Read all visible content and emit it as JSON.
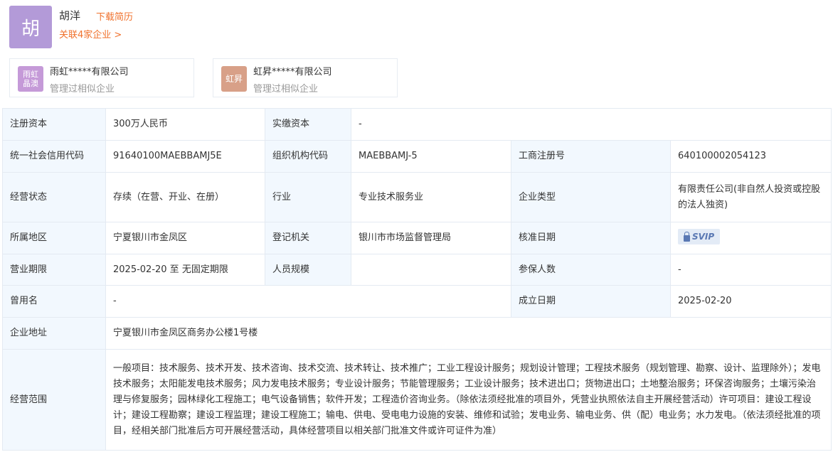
{
  "legal_rep": {
    "avatar_char": "胡",
    "name": "胡洋",
    "download_label": "下载简历",
    "related_label": "关联4家企业 >"
  },
  "related_companies": [
    {
      "logo_text": "雨虹\n晶澳",
      "name": "雨虹*****有限公司",
      "note": "管理过相似企业"
    },
    {
      "logo_text": "虹昇",
      "name": "虹昇*****有限公司",
      "note": "管理过相似企业"
    }
  ],
  "fields": {
    "reg_capital": {
      "label": "注册资本",
      "value": "300万人民币"
    },
    "paid_capital": {
      "label": "实缴资本",
      "value": "-"
    },
    "credit_code": {
      "label": "统一社会信用代码",
      "value": "91640100MAEBBAMJ5E"
    },
    "org_code": {
      "label": "组织机构代码",
      "value": "MAEBBAMJ-5"
    },
    "biz_reg_no": {
      "label": "工商注册号",
      "value": "640100002054123"
    },
    "status": {
      "label": "经营状态",
      "value": "存续（在营、开业、在册）"
    },
    "industry": {
      "label": "行业",
      "value": "专业技术服务业"
    },
    "company_type": {
      "label": "企业类型",
      "value": "有限责任公司(非自然人投资或控股的法人独资)"
    },
    "region": {
      "label": "所属地区",
      "value": "宁夏银川市金凤区"
    },
    "reg_authority": {
      "label": "登记机关",
      "value": "银川市市场监督管理局"
    },
    "approval_date": {
      "label": "核准日期",
      "badge": "SVIP"
    },
    "term": {
      "label": "营业期限",
      "value": "2025-02-20 至 无固定期限"
    },
    "staff_size": {
      "label": "人员规模",
      "value": ""
    },
    "insured": {
      "label": "参保人数",
      "value": "-"
    },
    "former_name": {
      "label": "曾用名",
      "value": "-"
    },
    "founded": {
      "label": "成立日期",
      "value": "2025-02-20"
    },
    "address": {
      "label": "企业地址",
      "value": "宁夏银川市金凤区商务办公楼1号楼"
    },
    "scope": {
      "label": "经营范围",
      "value": "一般项目：技术服务、技术开发、技术咨询、技术交流、技术转让、技术推广；工业工程设计服务；规划设计管理；工程技术服务（规划管理、勘察、设计、监理除外）；发电技术服务；太阳能发电技术服务；风力发电技术服务；专业设计服务；节能管理服务；工业设计服务；技术进出口；货物进出口；土地整治服务；环保咨询服务；土壤污染治理与修复服务；园林绿化工程施工；电气设备销售；软件开发；工程造价咨询业务。（除依法须经批准的项目外，凭营业执照依法自主开展经营活动）许可项目：建设工程设计；建设工程勘察；建设工程监理；建设工程施工；输电、供电、受电电力设施的安装、维修和试验；发电业务、输电业务、供（配）电业务；水力发电。（依法须经批准的项目，经相关部门批准后方可开展经营活动，具体经营项目以相关部门批准文件或许可证件为准）"
    }
  }
}
